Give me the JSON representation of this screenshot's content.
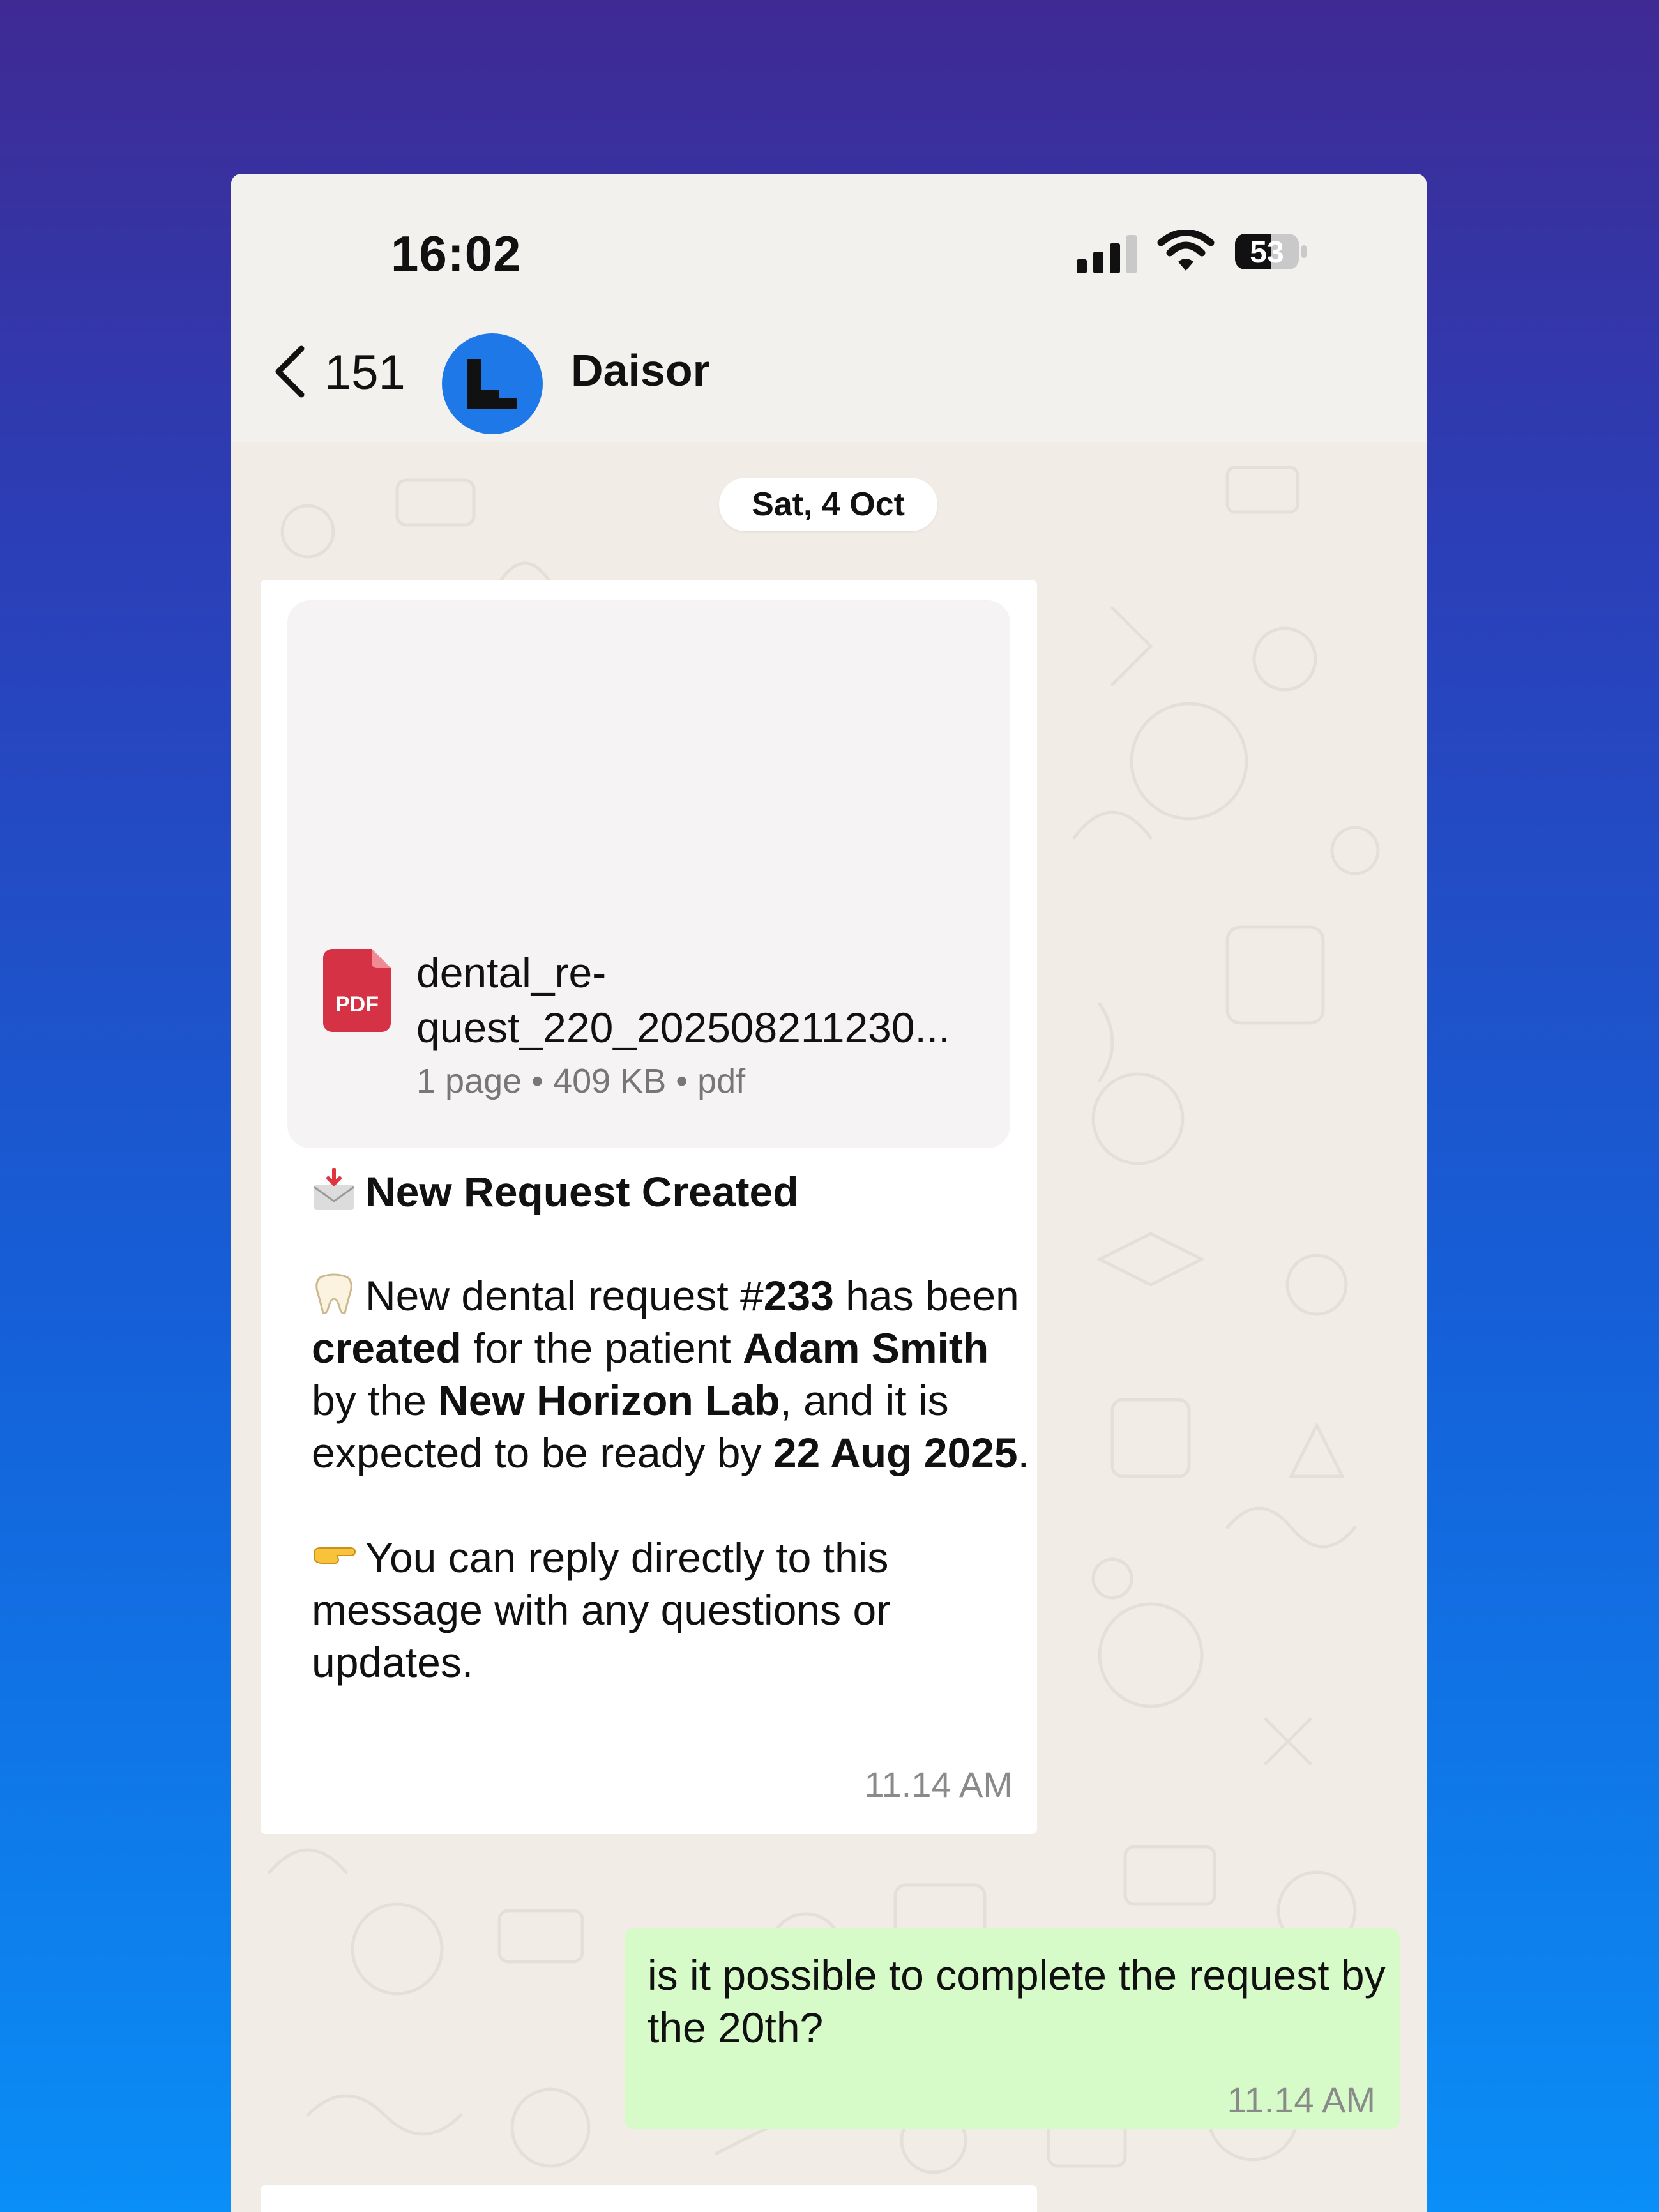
{
  "status_bar": {
    "time": "16:02",
    "battery": "53"
  },
  "nav": {
    "back_count": "151",
    "contact_name": "Daisor"
  },
  "chat": {
    "date_chip": "Sat, 4 Oct",
    "incoming": {
      "document": {
        "file_name": "dental_re-quest_220_202508211230...",
        "file_name_line1": "dental_re-",
        "file_name_line2": "quest_220_202508211230...",
        "meta": "1 page • 409 KB • pdf",
        "icon_label": "PDF"
      },
      "title": "New Request Created",
      "p1": {
        "t1": "New dental request #",
        "b1": "233",
        "t2": " has been ",
        "b2": "created",
        "t3": " for the patient ",
        "b3": "Adam Smith",
        "t4": " by the ",
        "b4": "New Horizon Lab",
        "t5": ", and it is expected to be ready by ",
        "b5": "22 Aug 2025",
        "t6": "."
      },
      "p2": "You can reply directly to this message with any questions or updates.",
      "time": "11.14 AM"
    },
    "outgoing": {
      "text": "is it possible to complete the request by the 20th?",
      "time": "11.14 AM"
    }
  },
  "colors": {
    "outgoing_bubble": "#d6fbc8",
    "avatar": "#1e78e8",
    "pdf_red": "#d63245",
    "chat_bg": "#f1ede6"
  },
  "icons": {
    "back": "chevron-left-icon",
    "signal": "signal-icon",
    "wifi": "wifi-icon",
    "battery": "battery-icon",
    "pdf": "pdf-file-icon",
    "envelope": "incoming-envelope-icon",
    "tooth": "tooth-icon",
    "pointing": "backhand-index-pointing-right-icon"
  }
}
